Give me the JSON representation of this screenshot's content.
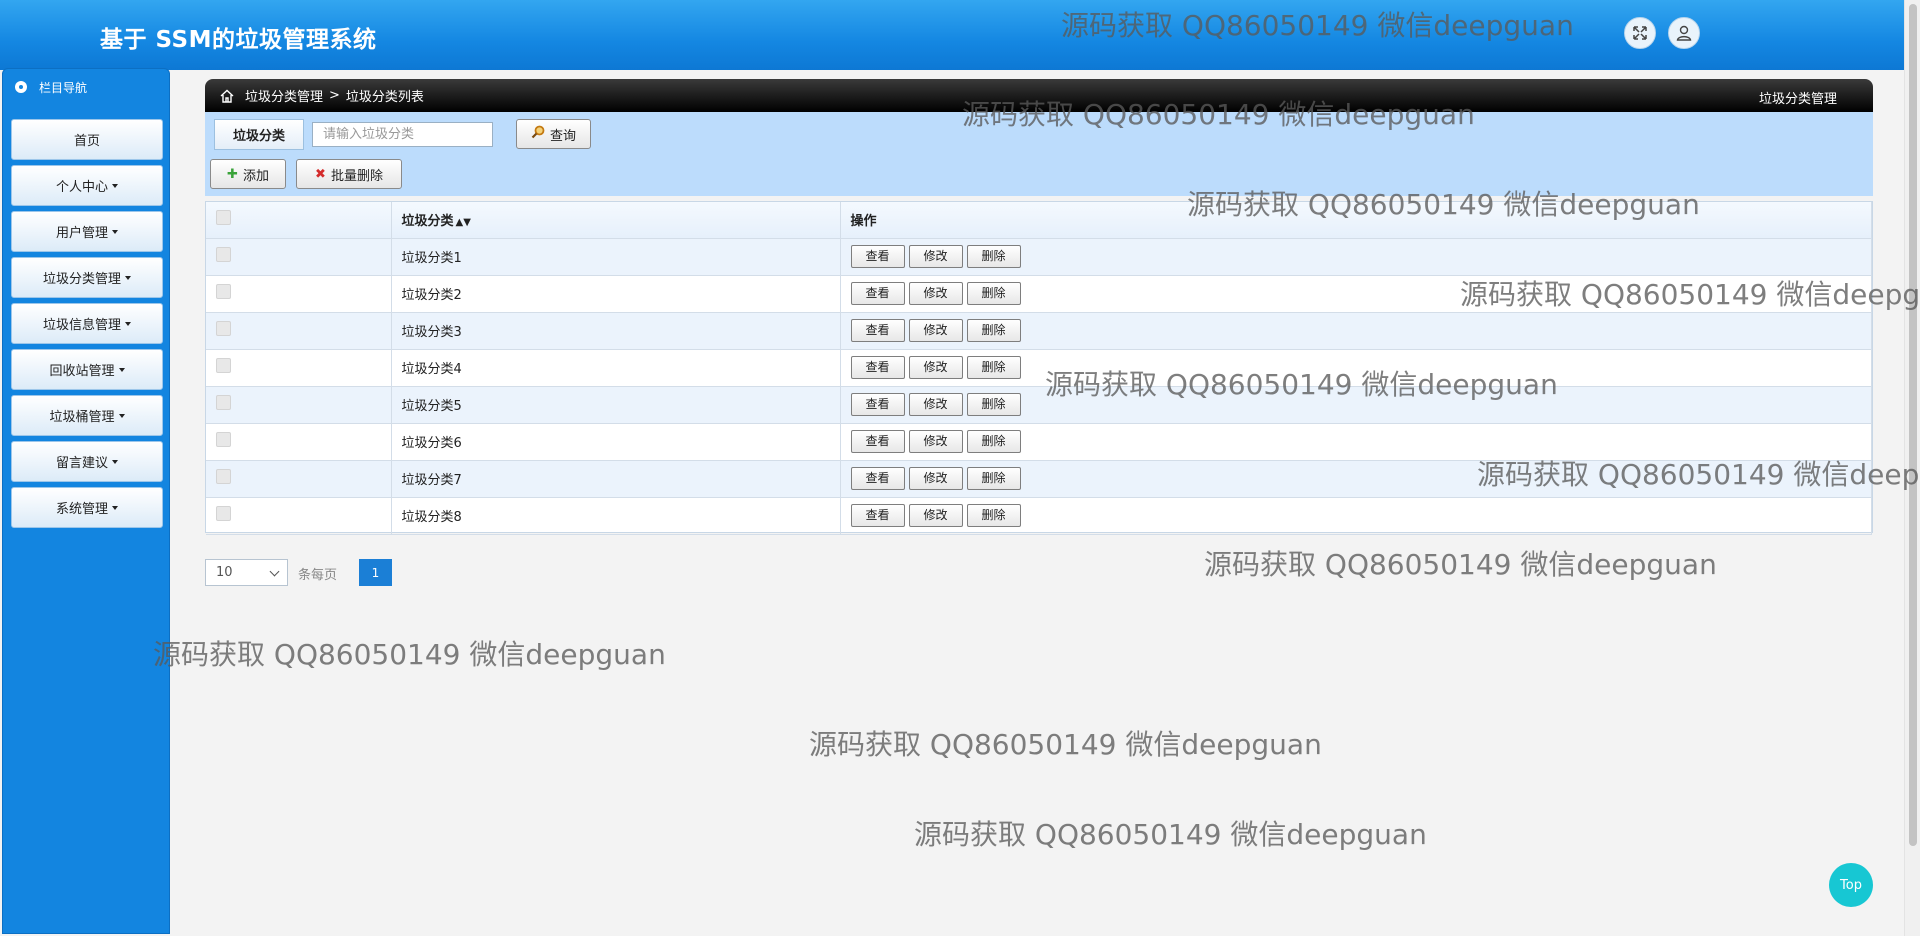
{
  "header": {
    "title": "基于 SSM的垃圾管理系统"
  },
  "sidebar": {
    "heading": "栏目导航",
    "items": [
      {
        "label": "首页",
        "dropdown": false
      },
      {
        "label": "个人中心",
        "dropdown": true
      },
      {
        "label": "用户管理",
        "dropdown": true
      },
      {
        "label": "垃圾分类管理",
        "dropdown": true
      },
      {
        "label": "垃圾信息管理",
        "dropdown": true
      },
      {
        "label": "回收站管理",
        "dropdown": true
      },
      {
        "label": "垃圾桶管理",
        "dropdown": true
      },
      {
        "label": "留言建议",
        "dropdown": true
      },
      {
        "label": "系统管理",
        "dropdown": true
      }
    ]
  },
  "breadcrumb": {
    "section": "垃圾分类管理",
    "separator": ">",
    "page": "垃圾分类列表",
    "right_title": "垃圾分类管理"
  },
  "search": {
    "label": "垃圾分类",
    "placeholder": "请输入垃圾分类",
    "value": "",
    "button": "查询"
  },
  "toolbar": {
    "add": "添加",
    "batch_delete": "批量删除"
  },
  "table": {
    "columns": [
      "",
      "垃圾分类",
      "操作"
    ],
    "rows": [
      {
        "name": "垃圾分类1"
      },
      {
        "name": "垃圾分类2"
      },
      {
        "name": "垃圾分类3"
      },
      {
        "name": "垃圾分类4"
      },
      {
        "name": "垃圾分类5"
      },
      {
        "name": "垃圾分类6"
      },
      {
        "name": "垃圾分类7"
      },
      {
        "name": "垃圾分类8"
      }
    ],
    "actions": {
      "view": "查看",
      "edit": "修改",
      "delete": "删除"
    }
  },
  "pagination": {
    "page_size": "10",
    "per_page_label": "条每页",
    "current_page": "1"
  },
  "watermark": "源码获取 QQ86050149 微信deepguan",
  "top_button": "Top",
  "colors": {
    "header": "#1487e2",
    "sidebar": "#1385e0",
    "search_bg": "#bcdcfc",
    "active_page": "#1b7fd6",
    "top_button": "#17c7d3"
  }
}
